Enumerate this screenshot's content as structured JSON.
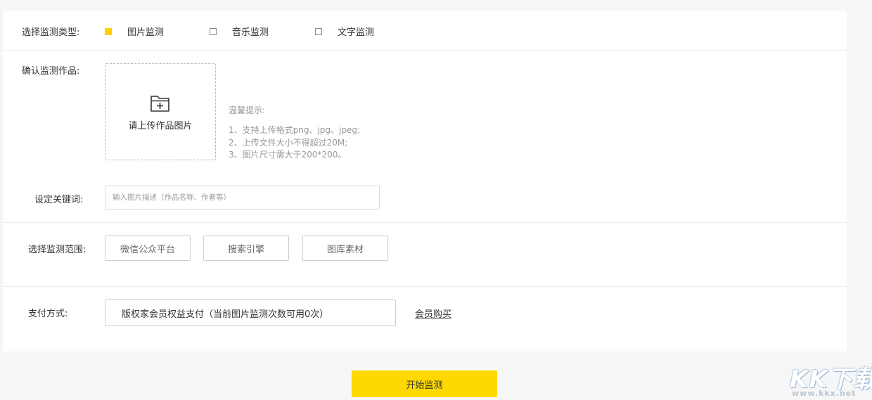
{
  "type_row": {
    "label": "选择监测类型:",
    "options": [
      {
        "label": "图片监测",
        "checked": true
      },
      {
        "label": "音乐监测",
        "checked": false
      },
      {
        "label": "文字监测",
        "checked": false
      }
    ]
  },
  "work_row": {
    "label": "确认监测作品:",
    "upload_text": "请上传作品图片",
    "upload_icon": "folder-plus-icon",
    "tips_title": "温馨提示:",
    "tips": [
      "1、支持上传格式png、jpg、jpeg;",
      "2、上传文件大小不得超过20M;",
      "3、图片尺寸需大于200*200。"
    ]
  },
  "keyword_row": {
    "label": "设定关键词:",
    "input_value": "",
    "placeholder": "输入图片描述（作品名称、作者等）"
  },
  "scope_row": {
    "label": "选择监测范围:",
    "options": [
      "微信公众平台",
      "搜索引擎",
      "图库素材"
    ]
  },
  "payment_row": {
    "label": "支付方式:",
    "method": "版权家会员权益支付（当前图片监测次数可用0次）",
    "link": "会员购买"
  },
  "start_button": "开始监测",
  "watermark": {
    "main": "KK下载",
    "sub": "www.kkx.net"
  },
  "colors": {
    "accent": "#ffd800",
    "checkbox_checked": "#ffd200",
    "page_background": "#f6f6f6",
    "card_background": "#ffffff",
    "border": "#cfcfcf",
    "tip_text": "#999999"
  }
}
